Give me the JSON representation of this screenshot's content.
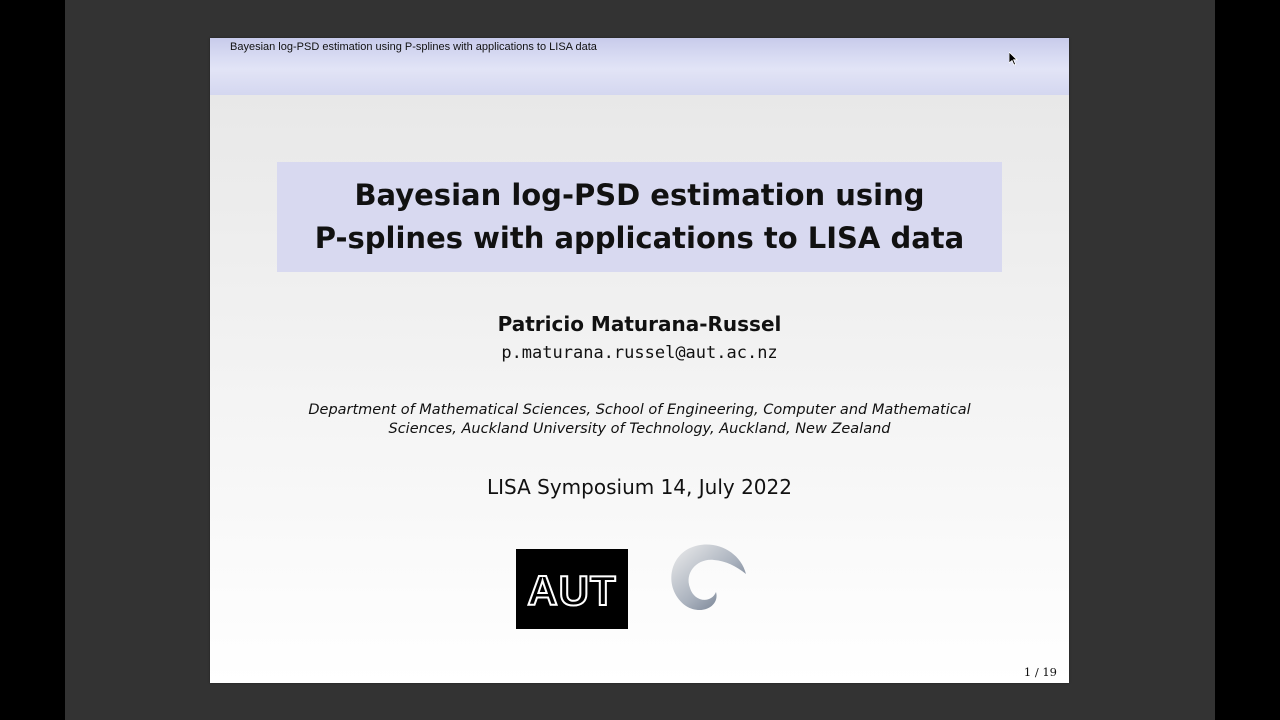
{
  "headline": "Bayesian log-PSD estimation using P-splines with applications to LISA data",
  "title": {
    "line1": "Bayesian log-PSD estimation using",
    "line2": "P-splines with applications to LISA data"
  },
  "author": "Patricio Maturana-Russel",
  "email": "p.maturana.russel@aut.ac.nz",
  "affiliation": {
    "line1": "Department of Mathematical Sciences, School of Engineering, Computer and Mathematical",
    "line2": "Sciences, Auckland University of Technology, Auckland, New Zealand"
  },
  "event": "LISA Symposium 14, July 2022",
  "logos": {
    "aut_text": "AUT",
    "swirl_icon": "swirl-logo-icon"
  },
  "page": "1 / 19",
  "colors": {
    "headline_bar": "#d4d7f0",
    "title_box": "#d8d9f0",
    "viewer_background": "#333333"
  }
}
